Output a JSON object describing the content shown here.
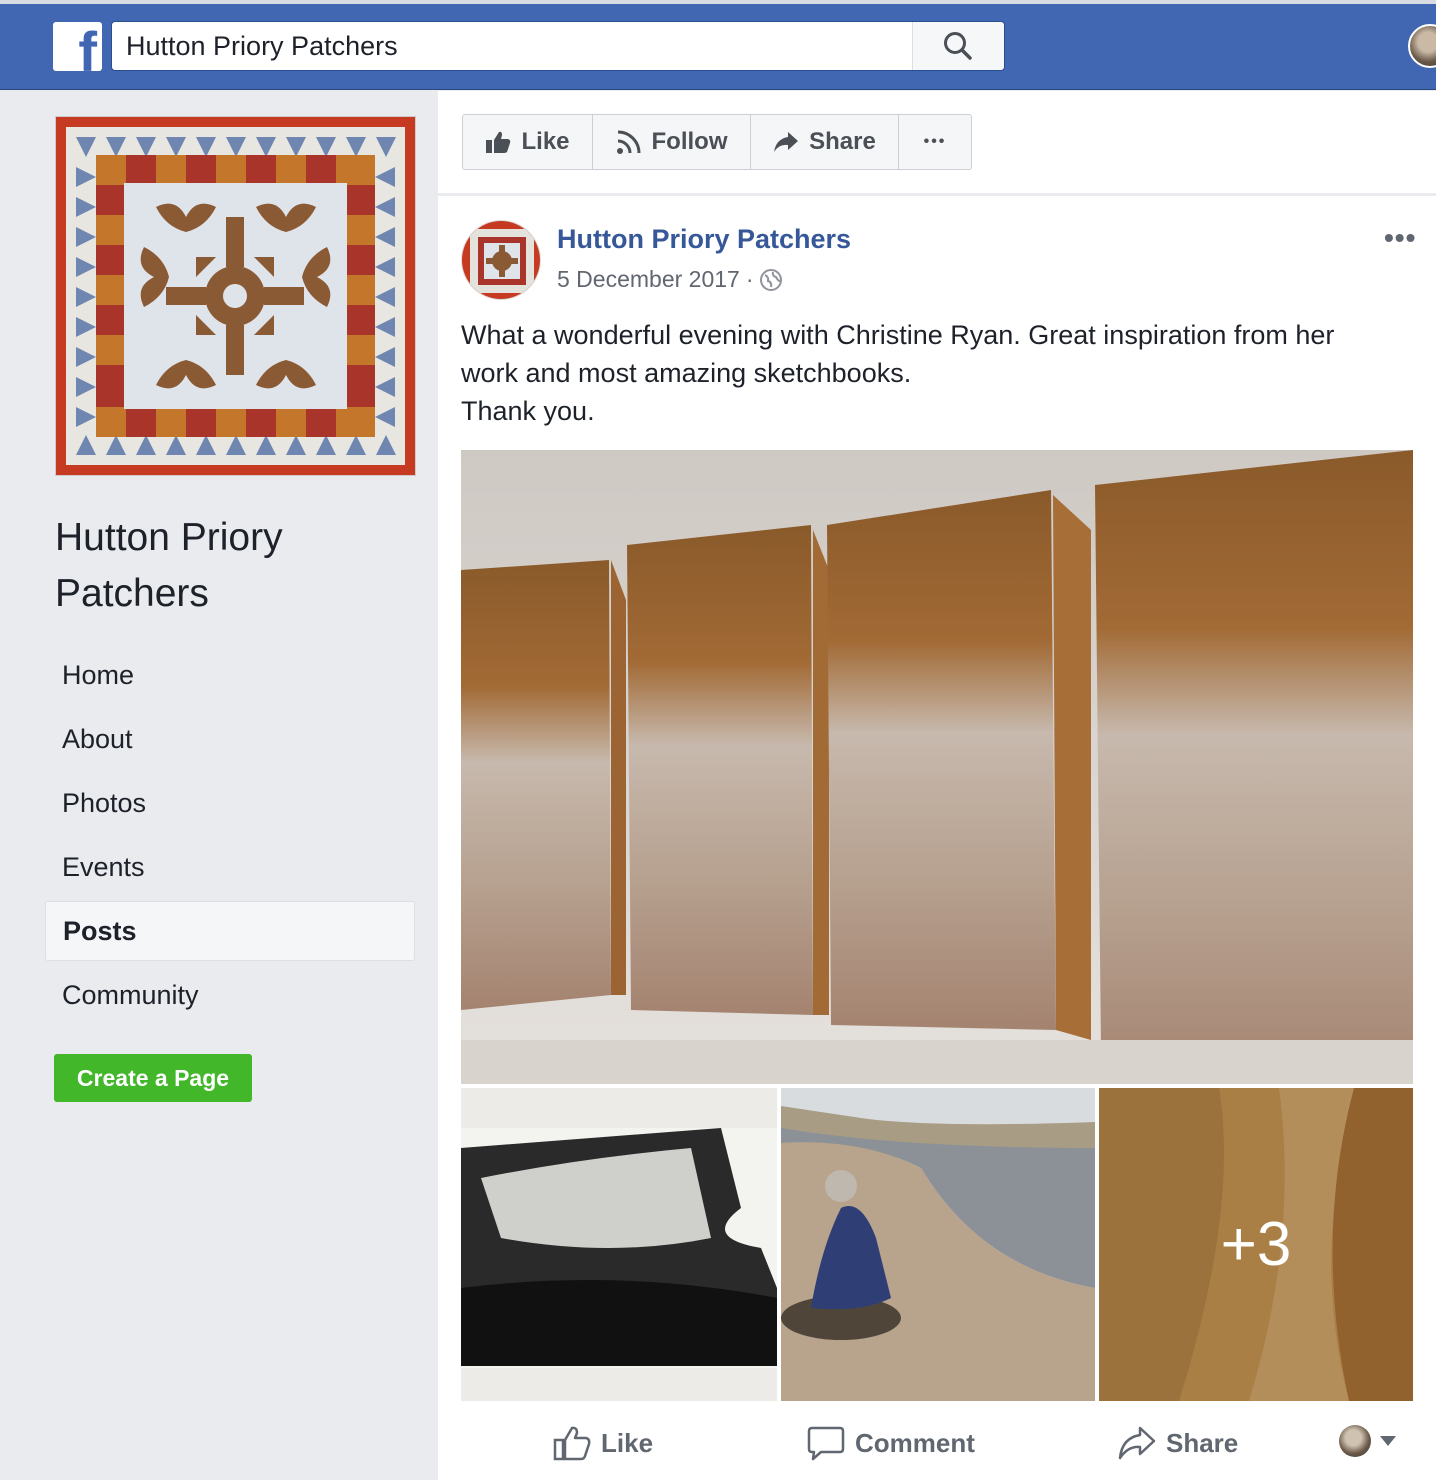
{
  "search": {
    "value": "Hutton Priory Patchers"
  },
  "page": {
    "name": "Hutton Priory Patchers"
  },
  "nav": {
    "items": [
      {
        "label": "Home"
      },
      {
        "label": "About"
      },
      {
        "label": "Photos"
      },
      {
        "label": "Events"
      },
      {
        "label": "Posts",
        "active": true
      },
      {
        "label": "Community"
      }
    ],
    "create_page_label": "Create a Page"
  },
  "page_actions": {
    "like_label": "Like",
    "follow_label": "Follow",
    "share_label": "Share",
    "more_label": "•••"
  },
  "post": {
    "author": "Hutton Priory Patchers",
    "date": "5 December 2017",
    "meta_separator": "·",
    "more_label": "•••",
    "text_lines": [
      "What a wonderful evening with Christine Ryan. Great inspiration from her",
      "work and most amazing sketchbooks.",
      "Thank you."
    ],
    "extra_photos_label": "+3",
    "actions": {
      "like_label": "Like",
      "comment_label": "Comment",
      "share_label": "Share"
    }
  },
  "colors": {
    "topbar": "#4267b2",
    "link": "#365899",
    "create_button": "#42b72a",
    "background": "#e9ebee"
  },
  "icons": [
    "facebook-logo",
    "search-icon",
    "like-icon",
    "rss-icon",
    "share-arrow-icon",
    "globe-icon",
    "comment-icon",
    "caret-down-icon"
  ]
}
